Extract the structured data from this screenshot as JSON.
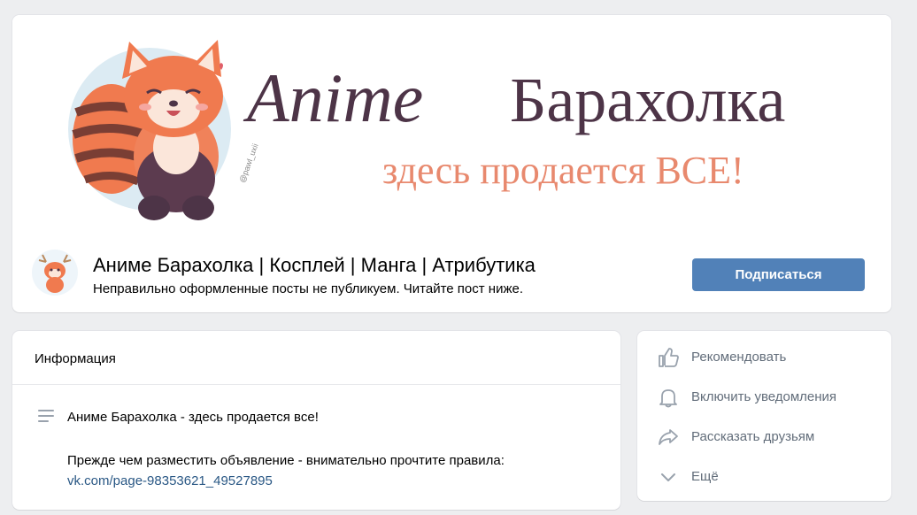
{
  "cover": {
    "title_word1": "Anime",
    "title_word2": "Барахолка",
    "tagline": "здесь продается ВСЕ!",
    "watermark": "@pawl_uxii",
    "colors": {
      "title": "#4d3447",
      "tagline": "#e8896e",
      "panda": "#f07a4f",
      "circle": "#dcebf3"
    }
  },
  "group": {
    "title": "Аниме Барахолка | Косплей | Манга | Атрибутика",
    "status": "Неправильно оформленные посты не публикуем. Читайте пост ниже.",
    "subscribe_label": "Подписаться"
  },
  "info": {
    "title": "Информация",
    "line1": "Аниме Барахолка - здесь продается все!",
    "line2": "Прежде чем разместить объявление - внимательно прочтите правила:",
    "link": "vk.com/page-98353621_49527895",
    "icon": "text-lines-icon"
  },
  "actions": [
    {
      "label": "Рекомендовать",
      "icon": "thumbs-up-icon"
    },
    {
      "label": "Включить уведомления",
      "icon": "bell-icon"
    },
    {
      "label": "Рассказать друзьям",
      "icon": "share-arrow-icon"
    },
    {
      "label": "Ещё",
      "icon": "chevron-down-icon"
    }
  ],
  "colors": {
    "accent": "#5181b8",
    "link": "#2a5885",
    "muted": "#626d7a",
    "page_bg": "#edeef0"
  }
}
